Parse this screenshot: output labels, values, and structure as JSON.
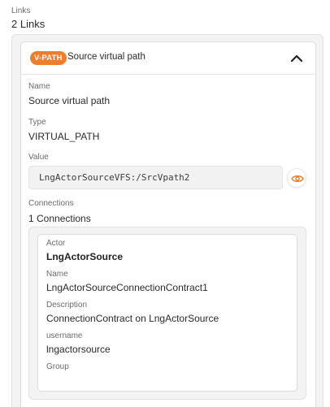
{
  "links": {
    "label": "Links",
    "count_text": "2 Links"
  },
  "link_card": {
    "badge": "V-PATH",
    "title": "Source virtual path",
    "expanded": true,
    "fields": {
      "name_label": "Name",
      "name_value": "Source virtual path",
      "type_label": "Type",
      "type_value": "VIRTUAL_PATH",
      "value_label": "Value",
      "value_text": "LngActorSourceVFS:/SrcVpath2"
    },
    "connections": {
      "label": "Connections",
      "count_text": "1 Connections",
      "items": [
        {
          "actor_label": "Actor",
          "actor_value": "LngActorSource",
          "name_label": "Name",
          "name_value": "LngActorSourceConnectionContract1",
          "description_label": "Description",
          "description_value": "ConnectionContract on LngActorSource",
          "username_label": "username",
          "username_value": "lngactorsource",
          "group_label": "Group",
          "group_value": ""
        }
      ]
    }
  },
  "icons": {
    "collapse": "chevron-up-icon",
    "reveal": "eye-icon"
  },
  "colors": {
    "badge_bg": "#f07d2a",
    "eye_icon": "#f07d2a"
  }
}
